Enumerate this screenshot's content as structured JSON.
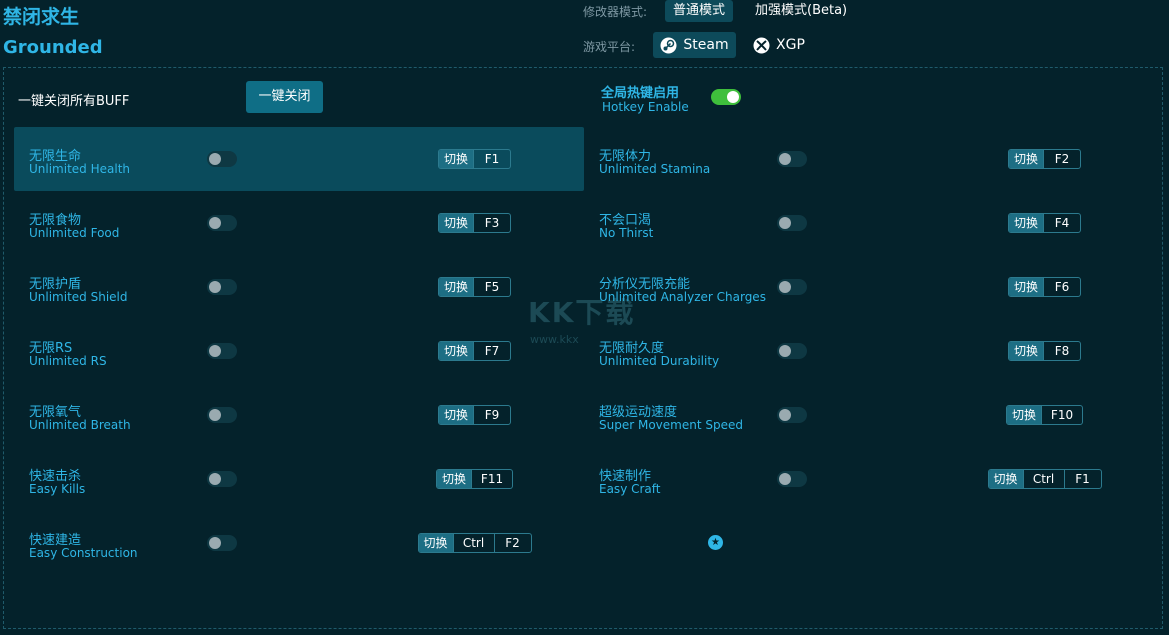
{
  "app": {
    "title_cn": "禁闭求生",
    "title_en": "Grounded"
  },
  "mode": {
    "label": "修改器模式:",
    "options": [
      "普通模式",
      "加强模式(Beta)"
    ],
    "selected": "普通模式"
  },
  "platform": {
    "label": "游戏平台:",
    "options": [
      "Steam",
      "XGP"
    ],
    "selected": "Steam"
  },
  "close_all": {
    "label": "一键关闭所有BUFF",
    "button": "一键关闭"
  },
  "hotkey": {
    "label_cn": "全局热键启用",
    "label_en": "Hotkey Enable",
    "enabled": true
  },
  "switch_label": "切换",
  "options": [
    {
      "cn": "无限生命",
      "en": "Unlimited Health",
      "keys": [
        "F1"
      ]
    },
    {
      "cn": "无限体力",
      "en": "Unlimited Stamina",
      "keys": [
        "F2"
      ]
    },
    {
      "cn": "无限食物",
      "en": "Unlimited Food",
      "keys": [
        "F3"
      ]
    },
    {
      "cn": "不会口渴",
      "en": "No Thirst",
      "keys": [
        "F4"
      ]
    },
    {
      "cn": "无限护盾",
      "en": "Unlimited Shield",
      "keys": [
        "F5"
      ]
    },
    {
      "cn": "分析仪无限充能",
      "en": "Unlimited Analyzer Charges",
      "keys": [
        "F6"
      ]
    },
    {
      "cn": "无限RS",
      "en": "Unlimited RS",
      "keys": [
        "F7"
      ]
    },
    {
      "cn": "无限耐久度",
      "en": "Unlimited Durability",
      "keys": [
        "F8"
      ]
    },
    {
      "cn": "无限氧气",
      "en": "Unlimited Breath",
      "keys": [
        "F9"
      ]
    },
    {
      "cn": "超级运动速度",
      "en": "Super Movement Speed",
      "keys": [
        "F10"
      ]
    },
    {
      "cn": "快速击杀",
      "en": "Easy Kills",
      "keys": [
        "F11"
      ]
    },
    {
      "cn": "快速制作",
      "en": "Easy Craft",
      "keys": [
        "Ctrl",
        "F1"
      ]
    },
    {
      "cn": "快速建造",
      "en": "Easy Construction",
      "keys": [
        "Ctrl",
        "F2"
      ],
      "badge": "star-icon"
    }
  ],
  "watermark": {
    "text": "KK下载",
    "url": "www.kkx"
  },
  "colors": {
    "accent": "#2fb6e6",
    "background": "#04222b",
    "toggle_on": "#3fbf3c"
  }
}
